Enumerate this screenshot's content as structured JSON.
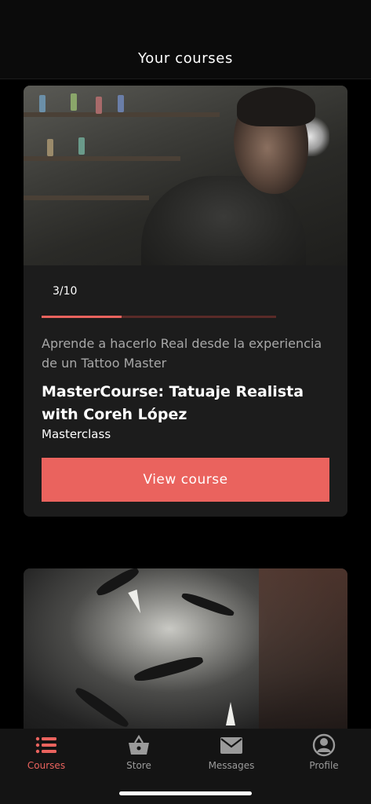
{
  "header": {
    "title": "Your courses"
  },
  "courses": [
    {
      "progress_label": "3/10",
      "progress_fraction": 0.34,
      "subtitle": "Aprende a hacerlo Real desde la experiencia de un Tattoo Master",
      "title": "MasterCourse: Tatuaje Realista with Coreh López",
      "type": "Masterclass",
      "button_label": "View course"
    }
  ],
  "tabs": [
    {
      "label": "Courses",
      "icon": "list-icon",
      "active": true
    },
    {
      "label": "Store",
      "icon": "basket-icon",
      "active": false
    },
    {
      "label": "Messages",
      "icon": "envelope-icon",
      "active": false
    },
    {
      "label": "Profile",
      "icon": "user-circle-icon",
      "active": false
    }
  ],
  "colors": {
    "accent": "#ea635e",
    "background": "#000000",
    "card": "#1c1c1c",
    "tabbar": "#141414"
  }
}
